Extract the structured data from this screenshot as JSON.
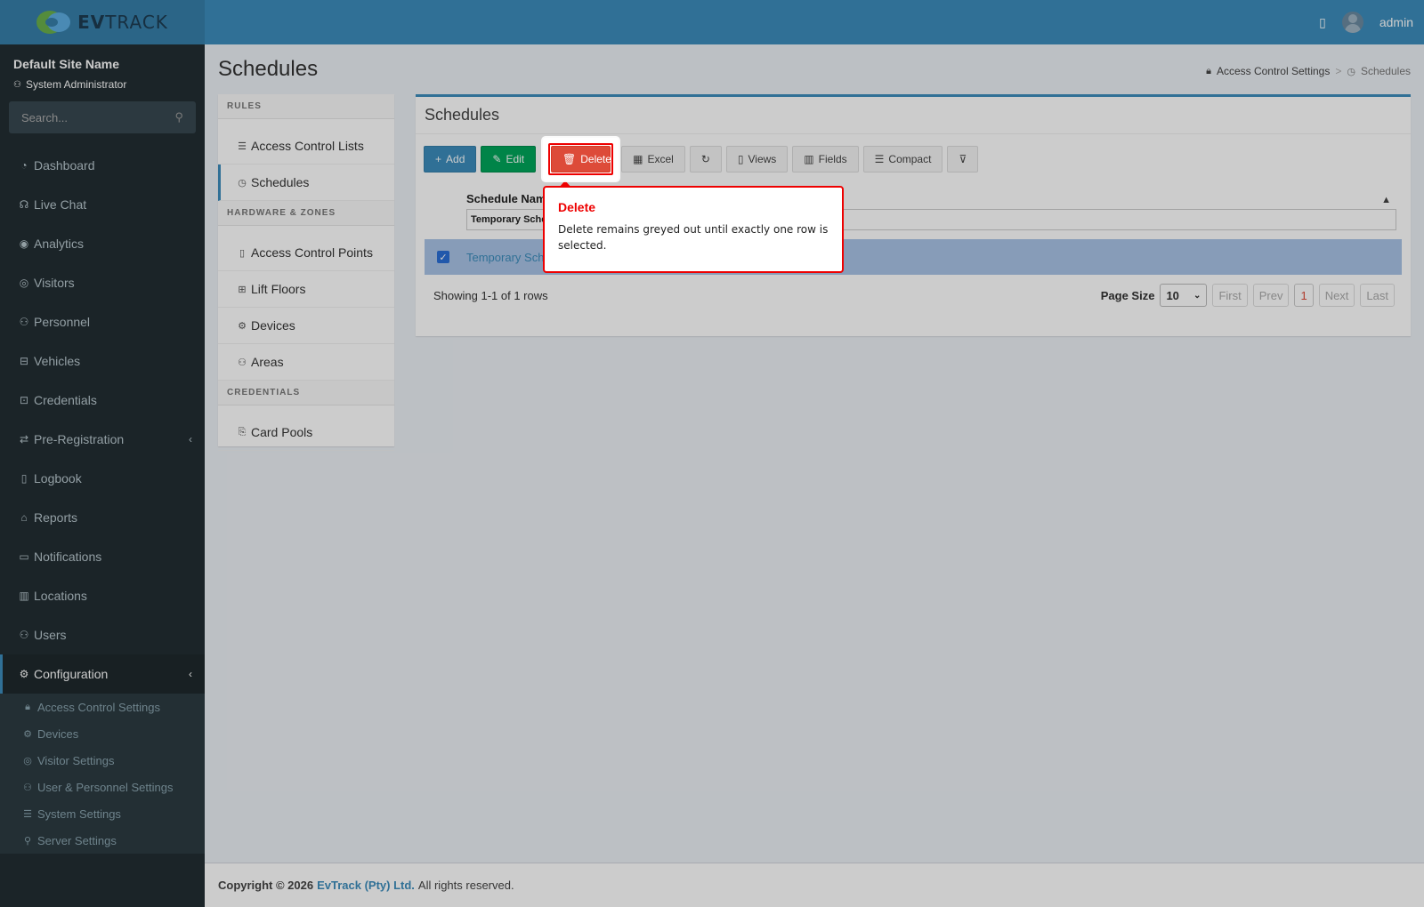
{
  "header": {
    "brand_prefix": "EV",
    "brand_suffix": "TRACK",
    "user": "admin",
    "book_icon": "book-icon",
    "avatar_icon": "user-avatar-icon"
  },
  "sidebar": {
    "site_name": "Default Site Name",
    "role": "System Administrator",
    "search_placeholder": "Search...",
    "items": [
      {
        "label": "Dashboard",
        "icon": "dashboard-icon"
      },
      {
        "label": "Live Chat",
        "icon": "headset-icon"
      },
      {
        "label": "Analytics",
        "icon": "target-icon"
      },
      {
        "label": "Visitors",
        "icon": "eye-icon"
      },
      {
        "label": "Personnel",
        "icon": "person-icon"
      },
      {
        "label": "Vehicles",
        "icon": "car-icon"
      },
      {
        "label": "Credentials",
        "icon": "id-card-icon"
      },
      {
        "label": "Pre-Registration",
        "icon": "arrows-icon"
      },
      {
        "label": "Logbook",
        "icon": "book-icon"
      },
      {
        "label": "Reports",
        "icon": "chart-icon"
      },
      {
        "label": "Notifications",
        "icon": "message-icon"
      },
      {
        "label": "Locations",
        "icon": "building-icon"
      },
      {
        "label": "Users",
        "icon": "users-icon"
      },
      {
        "label": "Configuration",
        "icon": "gear-icon"
      }
    ],
    "sub_items": [
      {
        "label": "Access Control Settings",
        "icon": "lock-icon"
      },
      {
        "label": "Devices",
        "icon": "device-icon"
      },
      {
        "label": "Visitor Settings",
        "icon": "eye-icon"
      },
      {
        "label": "User & Personnel Settings",
        "icon": "users-icon"
      },
      {
        "label": "System Settings",
        "icon": "sliders-icon"
      },
      {
        "label": "Server Settings",
        "icon": "server-icon"
      }
    ]
  },
  "page": {
    "title": "Schedules",
    "breadcrumb": [
      "Access Control Settings",
      ">",
      "Schedules"
    ]
  },
  "left_panel": {
    "sections": [
      {
        "header": "RULES",
        "items": [
          "Access Control Lists",
          "Schedules"
        ]
      },
      {
        "header": "HARDWARE & ZONES",
        "items": [
          "Access Control Points",
          "Lift Floors",
          "Devices",
          "Areas"
        ]
      },
      {
        "header": "CREDENTIALS",
        "items": [
          "Card Pools"
        ]
      }
    ]
  },
  "grid": {
    "title": "Schedules",
    "toolbar": {
      "add": "Add",
      "edit": "Edit",
      "delete": "Delete",
      "excel": "Excel",
      "views": "Views",
      "fields": "Fields",
      "compact": "Compact"
    },
    "column": "Schedule Name",
    "filter_value": "Temporary Schedule",
    "rows": [
      {
        "name": "Temporary Schedule",
        "selected": true
      }
    ],
    "showing": "Showing 1-1 of 1 rows",
    "page_size_label": "Page Size",
    "page_size": "10",
    "pager": {
      "first": "First",
      "prev": "Prev",
      "current": "1",
      "next": "Next",
      "last": "Last"
    }
  },
  "tooltip": {
    "title": "Delete",
    "text": "Delete remains greyed out until exactly one row is selected."
  },
  "footer": {
    "copyright": "Copyright © 2026",
    "company": "EvTrack (Pty) Ltd.",
    "rights": "All rights reserved."
  }
}
